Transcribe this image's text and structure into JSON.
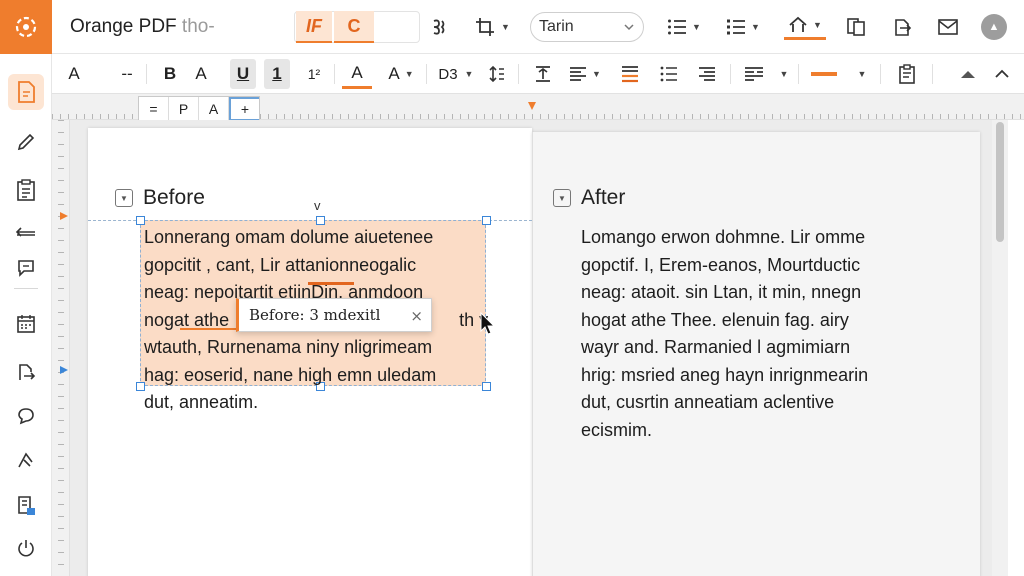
{
  "app": {
    "title": "Orange PDF",
    "title_faded": " tho-",
    "accent": "#ef7d2d"
  },
  "toolbar": {
    "highlight_btn_1": "IF",
    "highlight_btn_2": "C",
    "font_name": "Tarin",
    "avatar_glyph": "▲"
  },
  "format_bar": {
    "font_a": "A",
    "dash": "--",
    "bold": "B",
    "font_size_a": "A",
    "underline": "U",
    "underline_alt": "1",
    "superscript": "1²",
    "font_color": "A",
    "text_size": "A",
    "text_glyph": "D3"
  },
  "mini_tools": [
    "=",
    "P",
    "A",
    "+"
  ],
  "document": {
    "before_heading": "Before",
    "after_heading": "After",
    "rotate_glyph": "v",
    "before_lines": [
      "Lonnerang omam dolume aiuetenee",
      "gopcitit , cant, Lir attanionneogalic",
      "neag: nepoitartit etiinDin, anmdoon",
      "nogat athe",
      "wtauth, Rurnenama niny nligrimeam",
      "hag: eoserid, nane high emn uledam",
      "dut, anneatim."
    ],
    "before_line4_tail": "th v",
    "after_lines": [
      "Lomango erwon dohmne. Lir omme",
      "gopctif. I, Erem-eanos, Mourtductic",
      "neag: ataoit. sin Ltan, it min, nnegn",
      "hogat athe Thee. elenuin fag. airy",
      "wayr and. Rarmanied l agmimiarn",
      "hrig: msried aneg hayn inrignmearin",
      "dut, cusrtin anneatiam aclentive",
      "ecismim."
    ],
    "tooltip_text": "Before: 3 mdexitl",
    "tooltip_close": "×"
  }
}
